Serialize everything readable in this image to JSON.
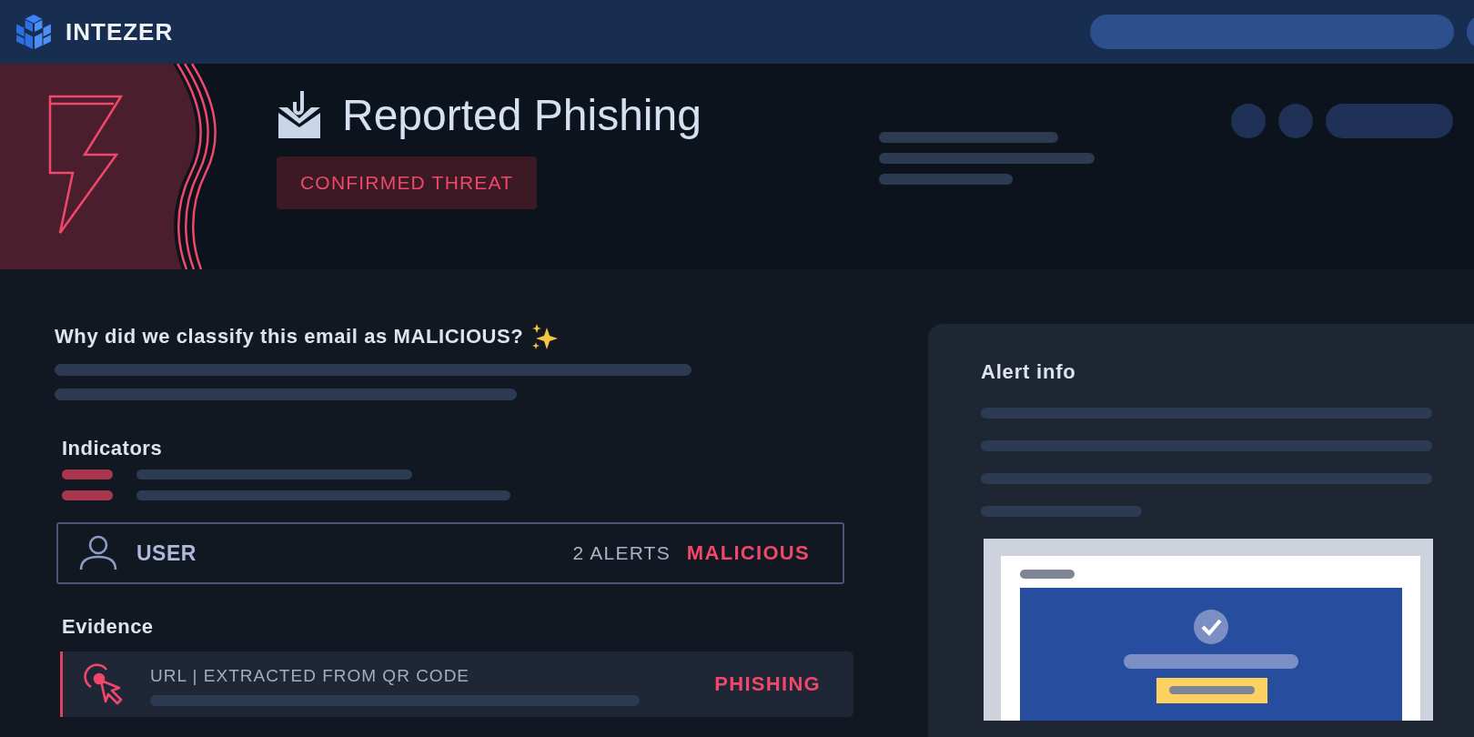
{
  "topbar": {
    "brand": "INTEZER"
  },
  "header": {
    "title": "Reported Phishing",
    "badge": "CONFIRMED THREAT"
  },
  "analysis": {
    "question": "Why did we classify this email as MALICIOUS?"
  },
  "indicators": {
    "title": "Indicators"
  },
  "entity": {
    "label": "USER",
    "count": "2 ALERTS",
    "verdict": "MALICIOUS"
  },
  "evidence": {
    "title": "Evidence",
    "items": [
      {
        "source": "URL | EXTRACTED FROM QR CODE",
        "verdict": "PHISHING"
      }
    ]
  },
  "alert_info": {
    "title": "Alert info"
  }
}
